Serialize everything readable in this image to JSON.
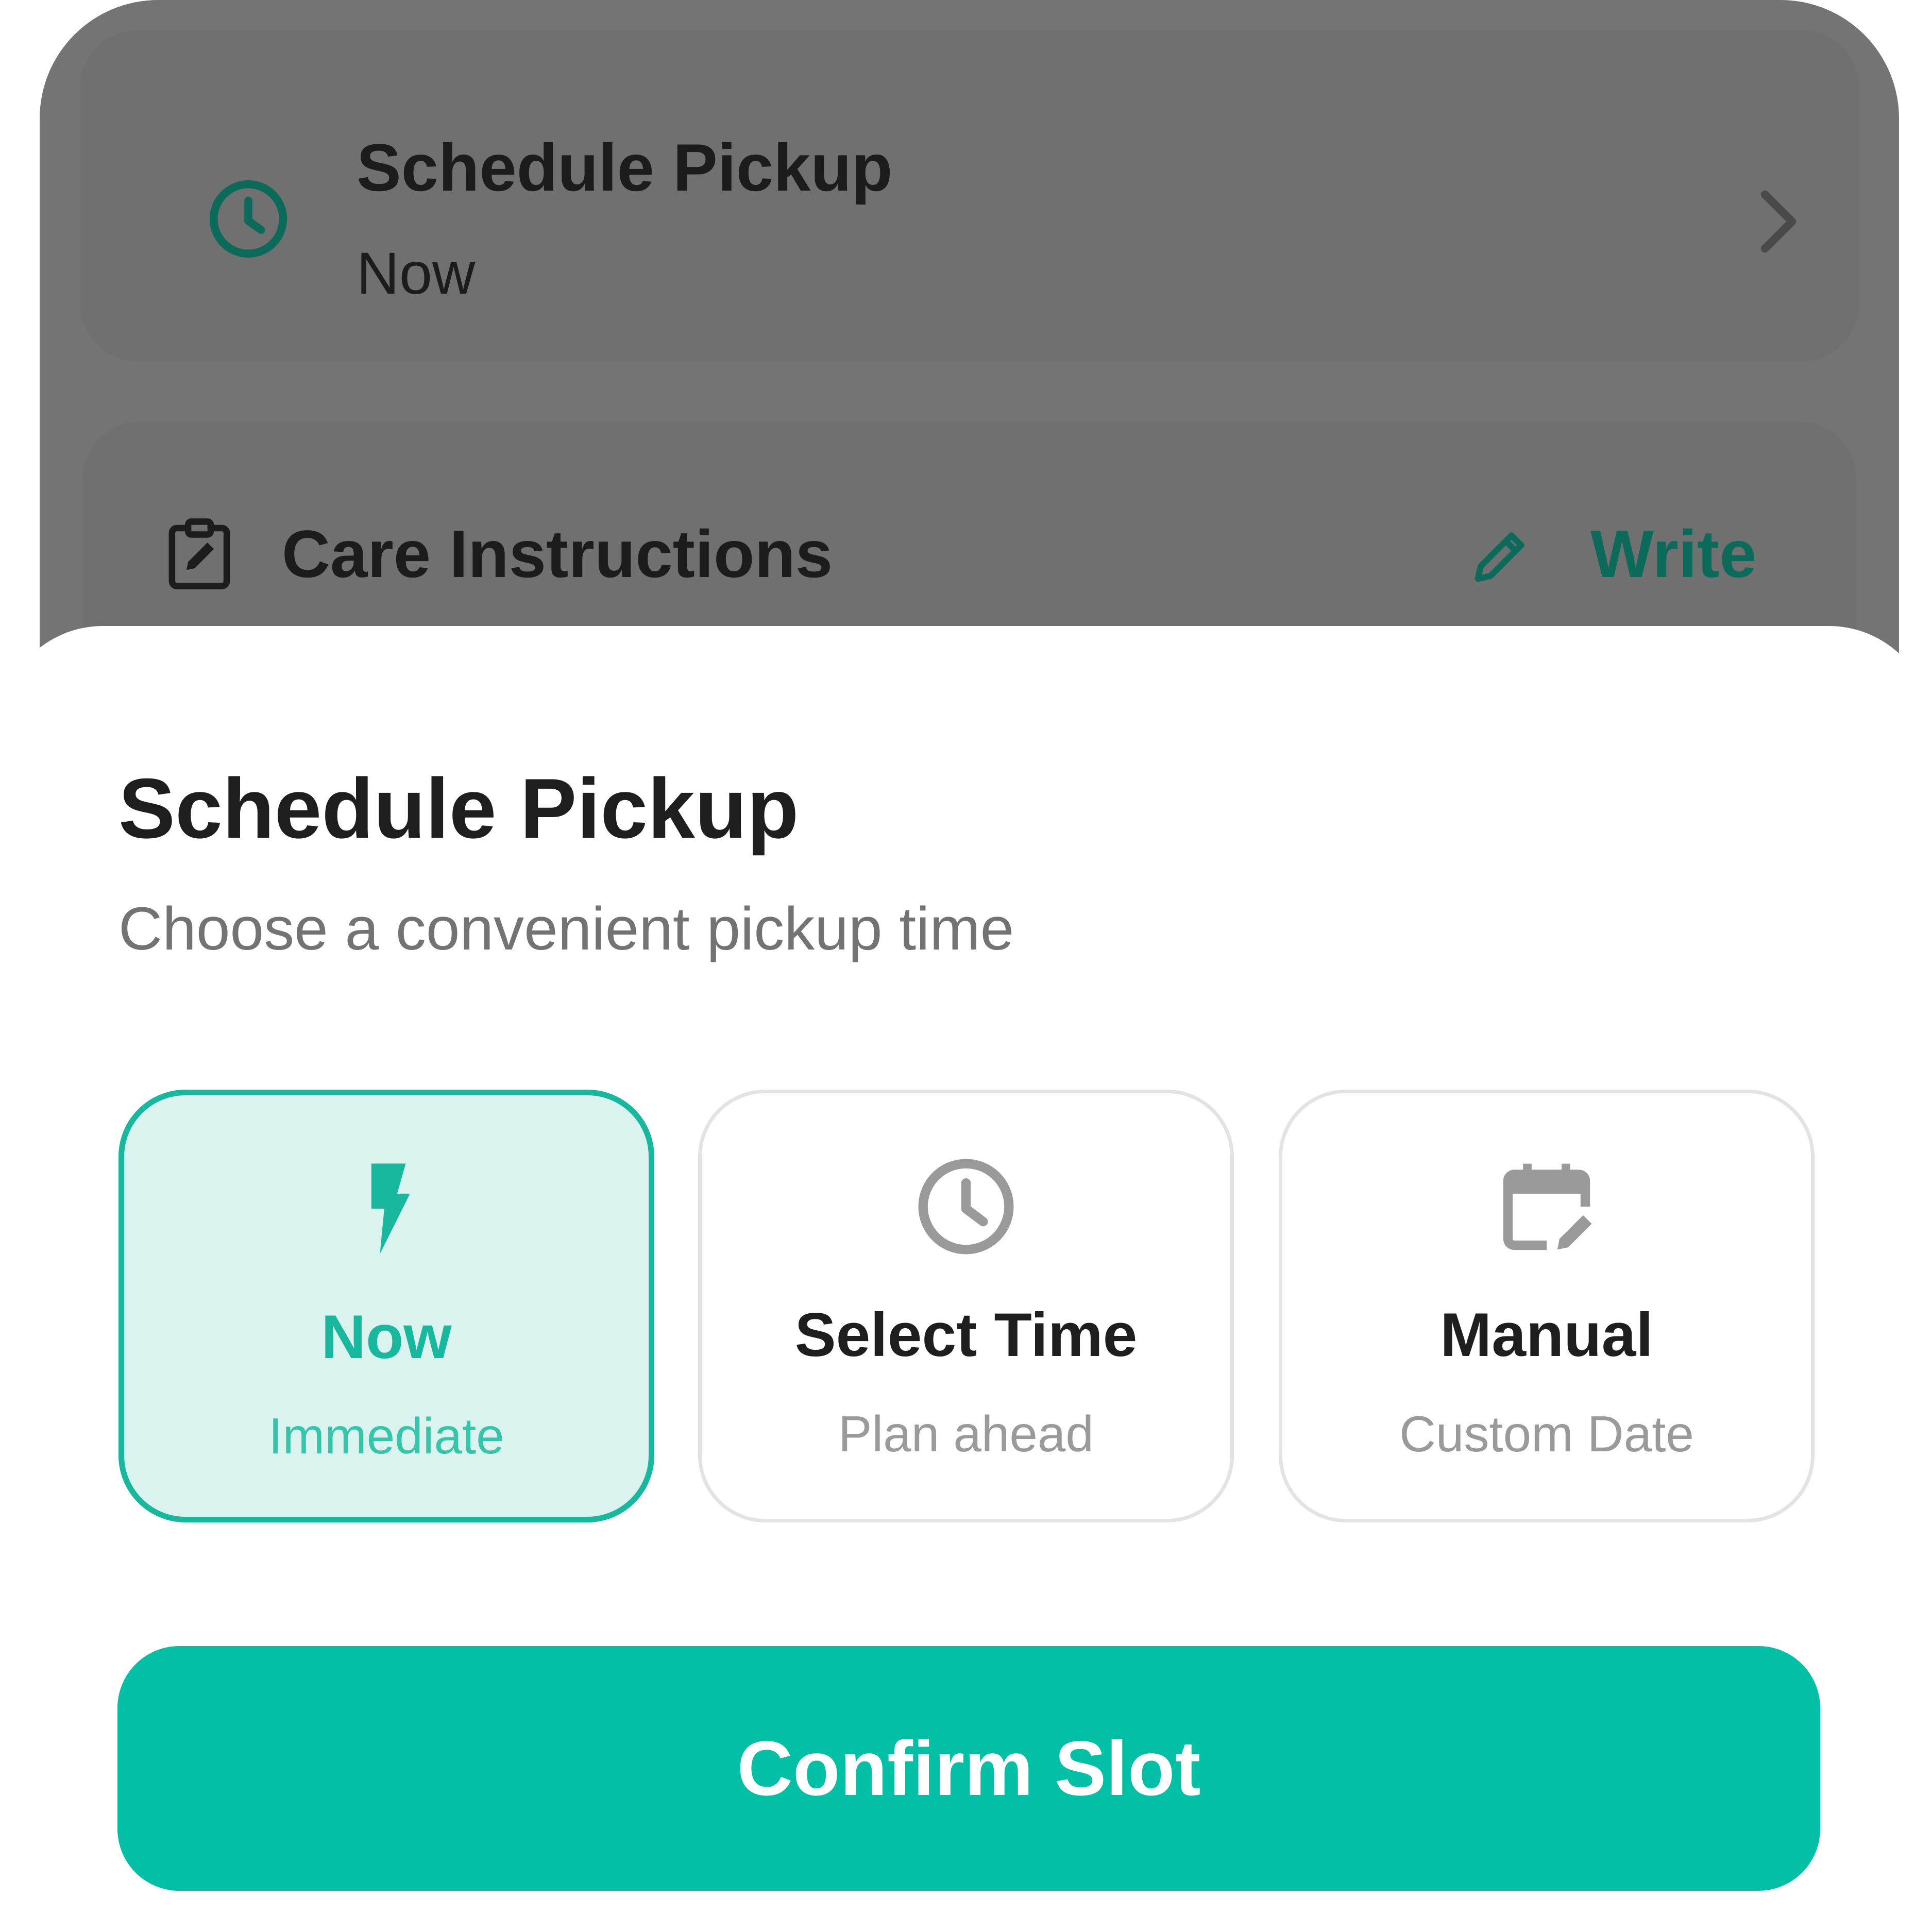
{
  "background": {
    "pickup_card": {
      "title": "Schedule Pickup",
      "value": "Now",
      "icon": "clock-icon",
      "chevron_icon": "chevron-right-icon"
    },
    "care_card": {
      "title": "Care Instructions",
      "icon": "clipboard-edit-icon",
      "action_label": "Write",
      "action_icon": "pencil-icon"
    }
  },
  "sheet": {
    "title": "Schedule Pickup",
    "subtitle": "Choose a convenient pickup time",
    "options": [
      {
        "label": "Now",
        "sub": "Immediate",
        "icon": "lightning-bolt-icon",
        "selected": true
      },
      {
        "label": "Select Time",
        "sub": "Plan ahead",
        "icon": "clock-icon",
        "selected": false
      },
      {
        "label": "Manual",
        "sub": "Custom Date",
        "icon": "calendar-edit-icon",
        "selected": false
      }
    ],
    "confirm_label": "Confirm Slot"
  },
  "colors": {
    "accent": "#02bfa6",
    "accent_dark": "#0b6a5a",
    "selected_bg": "#dbf3ef",
    "overlay": "#747474"
  }
}
